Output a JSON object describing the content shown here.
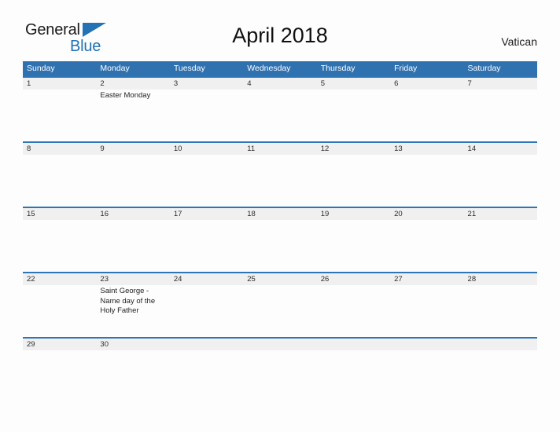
{
  "brand": {
    "name_part1": "General",
    "name_part2": "Blue",
    "accent_color": "#2272b4"
  },
  "header": {
    "title": "April 2018",
    "region": "Vatican"
  },
  "calendar": {
    "header_color": "#3071b0",
    "separator_color": "#2e75b6",
    "date_band_color": "#f0f0f0",
    "day_names": [
      "Sunday",
      "Monday",
      "Tuesday",
      "Wednesday",
      "Thursday",
      "Friday",
      "Saturday"
    ],
    "weeks": [
      {
        "size": "tall",
        "days": [
          {
            "date": "1",
            "event": ""
          },
          {
            "date": "2",
            "event": "Easter Monday"
          },
          {
            "date": "3",
            "event": ""
          },
          {
            "date": "4",
            "event": ""
          },
          {
            "date": "5",
            "event": ""
          },
          {
            "date": "6",
            "event": ""
          },
          {
            "date": "7",
            "event": ""
          }
        ]
      },
      {
        "size": "tall",
        "days": [
          {
            "date": "8",
            "event": ""
          },
          {
            "date": "9",
            "event": ""
          },
          {
            "date": "10",
            "event": ""
          },
          {
            "date": "11",
            "event": ""
          },
          {
            "date": "12",
            "event": ""
          },
          {
            "date": "13",
            "event": ""
          },
          {
            "date": "14",
            "event": ""
          }
        ]
      },
      {
        "size": "tall",
        "days": [
          {
            "date": "15",
            "event": ""
          },
          {
            "date": "16",
            "event": ""
          },
          {
            "date": "17",
            "event": ""
          },
          {
            "date": "18",
            "event": ""
          },
          {
            "date": "19",
            "event": ""
          },
          {
            "date": "20",
            "event": ""
          },
          {
            "date": "21",
            "event": ""
          }
        ]
      },
      {
        "size": "tall",
        "days": [
          {
            "date": "22",
            "event": ""
          },
          {
            "date": "23",
            "event": "Saint George - Name day of the Holy Father"
          },
          {
            "date": "24",
            "event": ""
          },
          {
            "date": "25",
            "event": ""
          },
          {
            "date": "26",
            "event": ""
          },
          {
            "date": "27",
            "event": ""
          },
          {
            "date": "28",
            "event": ""
          }
        ]
      },
      {
        "size": "short",
        "days": [
          {
            "date": "29",
            "event": ""
          },
          {
            "date": "30",
            "event": ""
          },
          {
            "date": "",
            "event": ""
          },
          {
            "date": "",
            "event": ""
          },
          {
            "date": "",
            "event": ""
          },
          {
            "date": "",
            "event": ""
          },
          {
            "date": "",
            "event": ""
          }
        ]
      }
    ]
  }
}
